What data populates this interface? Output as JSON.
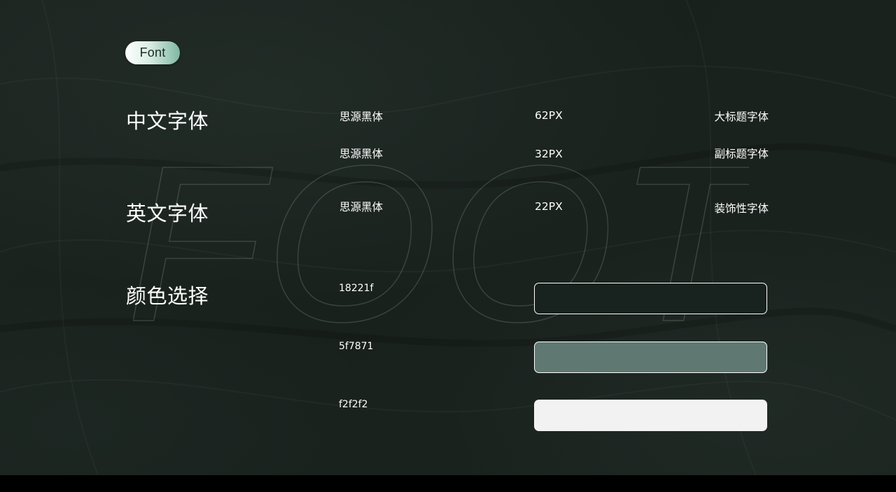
{
  "tag_label": "Font",
  "watermark_text": "FOOT",
  "sections": {
    "chinese_font": "中文字体",
    "english_font": "英文字体",
    "color_selection": "颜色选择"
  },
  "font_rows": [
    {
      "font": "思源黑体",
      "size": "62PX",
      "usage": "大标题字体"
    },
    {
      "font": "思源黑体",
      "size": "32PX",
      "usage": "副标题字体"
    },
    {
      "font": "思源黑体",
      "size": "22PX",
      "usage": "装饰性字体"
    }
  ],
  "colors": [
    {
      "hex": "18221f",
      "swatch": "#18221f"
    },
    {
      "hex": "5f7871",
      "swatch": "#5f7871"
    },
    {
      "hex": "f2f2f2",
      "swatch": "#f2f2f2"
    }
  ]
}
